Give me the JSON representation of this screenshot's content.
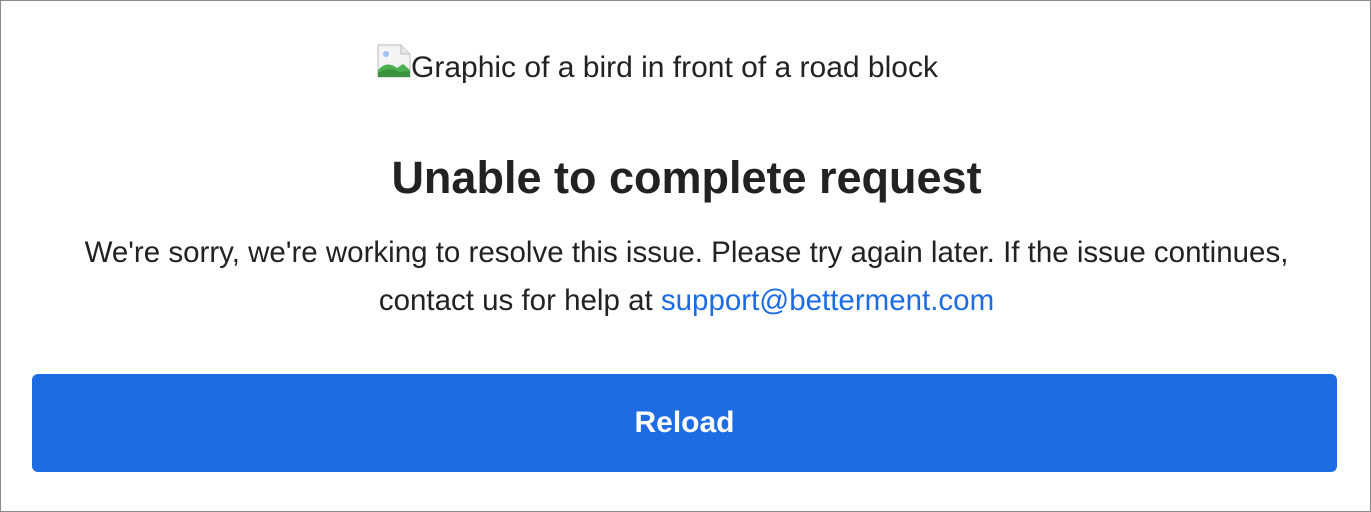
{
  "image": {
    "alt_text": "Graphic of a bird in front of a road block",
    "icon": "broken-image-icon"
  },
  "error": {
    "title": "Unable to complete request",
    "message_part1": "We're sorry, we're working to resolve this issue. Please try again later. If the issue continues, contact us for help at ",
    "support_email": "support@betterment.com"
  },
  "actions": {
    "reload_label": "Reload"
  },
  "colors": {
    "accent": "#1e6ce3",
    "link": "#1d6ce3",
    "text": "#222222",
    "border": "#8a8a8a"
  }
}
